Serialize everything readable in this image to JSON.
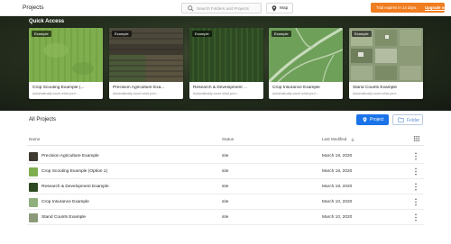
{
  "header": {
    "title": "Projects",
    "search_placeholder": "Search Folders and Projects",
    "map_label": "Map",
    "trial_text": "Trial expires in 14 days.",
    "upgrade_label": "Upgrade now"
  },
  "quick_access": {
    "title": "Quick Access",
    "cards": [
      {
        "badge": "Example",
        "name": "Crop Scouting Example (...",
        "desc": "Automatically count what you'r..."
      },
      {
        "badge": "Example",
        "name": "Precision Agriculture Exa...",
        "desc": "Automatically count what you'r..."
      },
      {
        "badge": "Example",
        "name": "Research & Development ...",
        "desc": "Automatically count what you'r..."
      },
      {
        "badge": "Example",
        "name": "Crop Insurance Example",
        "desc": "Automatically count what you'r..."
      },
      {
        "badge": "Example",
        "name": "Stand Counts Example",
        "desc": "Automatically count what you'r..."
      }
    ]
  },
  "projects": {
    "title": "All Projects",
    "new_project_label": "Project",
    "new_folder_label": "Folder",
    "columns": {
      "name": "Name",
      "status": "Status",
      "modified": "Last Modified"
    },
    "rows": [
      {
        "name": "Precision Agriculture Example",
        "status": "site",
        "modified": "March 18, 2020"
      },
      {
        "name": "Crop Scouting Example (Option 1)",
        "status": "site",
        "modified": "March 18, 2020"
      },
      {
        "name": "Research & Development Example",
        "status": "site",
        "modified": "March 18, 2020"
      },
      {
        "name": "Crop Insurance Example",
        "status": "site",
        "modified": "March 10, 2020"
      },
      {
        "name": "Stand Counts Example",
        "status": "site",
        "modified": "March 10, 2020"
      }
    ]
  },
  "colors": {
    "accent_blue": "#1a73e8",
    "trial_orange": "#f07d1f"
  }
}
